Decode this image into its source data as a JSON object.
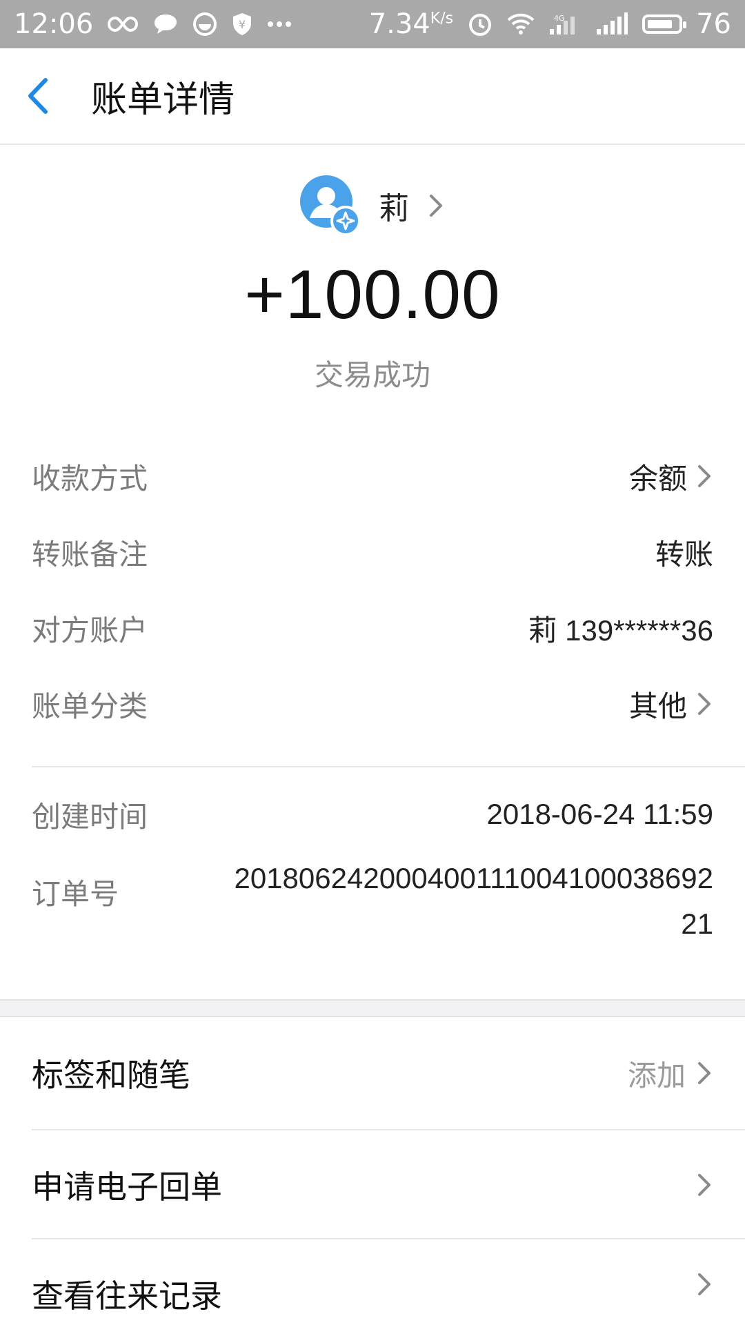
{
  "status_bar": {
    "time": "12:06",
    "speed": "7.34",
    "speed_unit": "K/s",
    "battery": "76"
  },
  "header": {
    "title": "账单详情"
  },
  "summary": {
    "payer_name": "莉",
    "amount": "+100.00",
    "status": "交易成功"
  },
  "details": [
    {
      "label": "收款方式",
      "value": "余额",
      "has_chevron": true
    },
    {
      "label": "转账备注",
      "value": "转账",
      "has_chevron": false
    },
    {
      "label": "对方账户",
      "value": "莉 139******36",
      "has_chevron": false
    },
    {
      "label": "账单分类",
      "value": "其他",
      "has_chevron": true
    }
  ],
  "meta": {
    "created_label": "创建时间",
    "created_value": "2018-06-24 11:59",
    "order_label": "订单号",
    "order_line1": "20180624200040011100410003869​2",
    "order_line2": "21"
  },
  "actions": [
    {
      "label": "标签和随笔",
      "right_text": "添加"
    },
    {
      "label": "申请电子回单",
      "right_text": ""
    },
    {
      "label": "查看往来记录",
      "right_text": ""
    }
  ],
  "colors": {
    "accent": "#1e88e5",
    "avatar": "#4aa3ea",
    "status_bar": "#a9a9a9"
  }
}
